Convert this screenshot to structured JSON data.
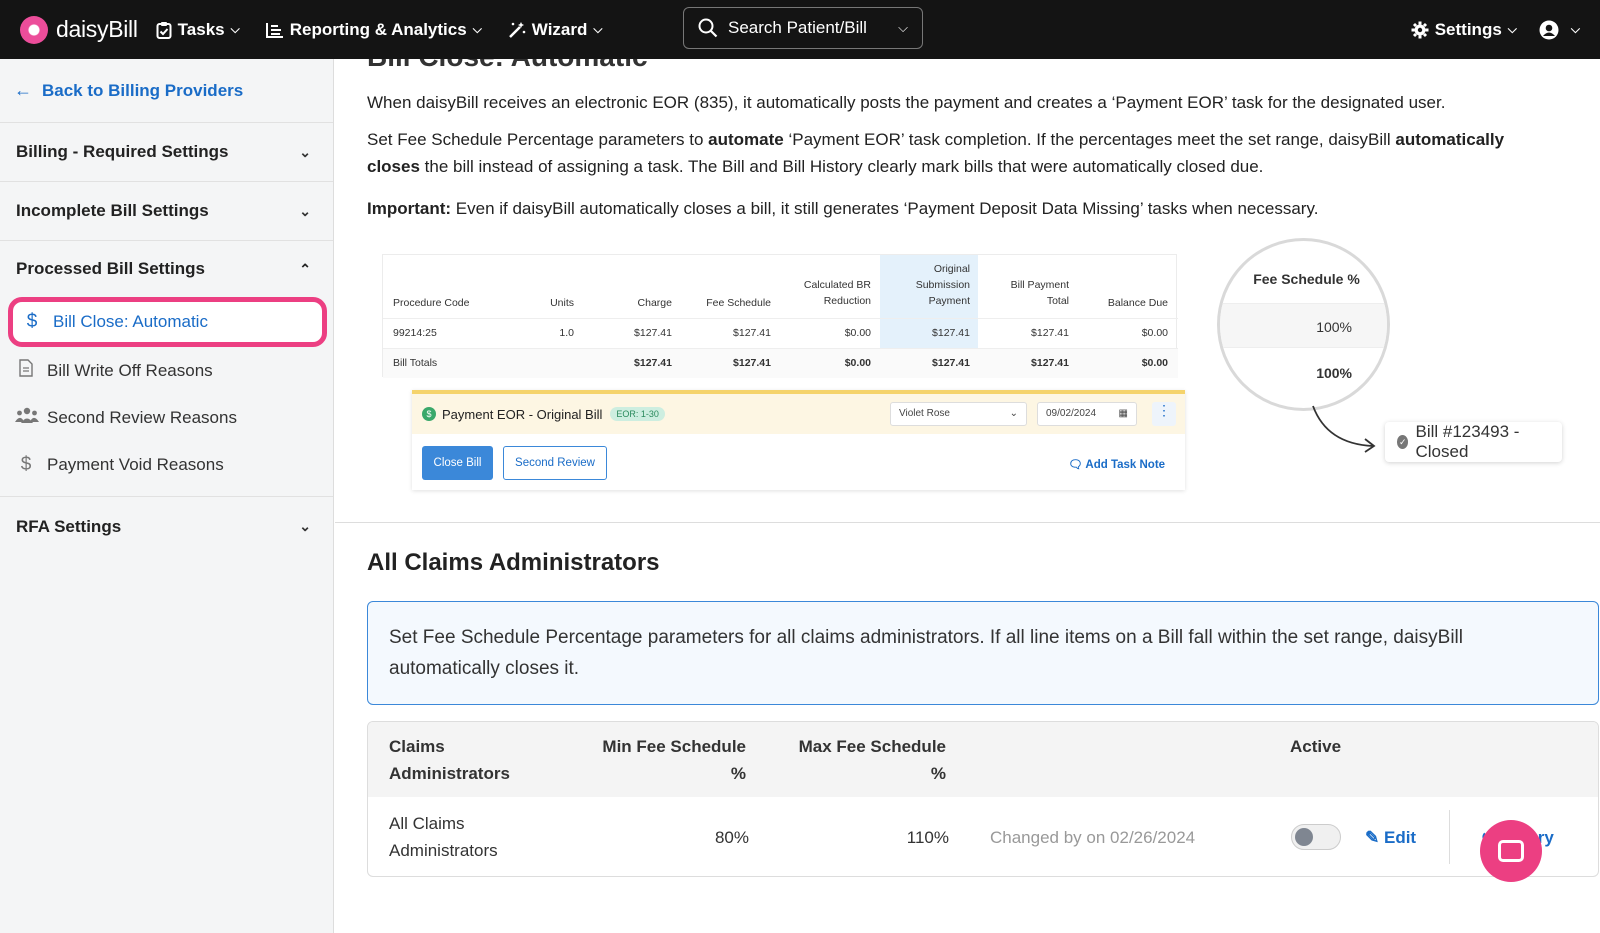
{
  "topbar": {
    "logo_text": "daisyBill",
    "nav": [
      {
        "label": "Tasks"
      },
      {
        "label": "Reporting & Analytics"
      },
      {
        "label": "Wizard"
      }
    ],
    "search_label": "Search Patient/Bill",
    "settings_label": "Settings"
  },
  "sidebar": {
    "back_label": "Back to Billing Providers",
    "sections": {
      "billing_required": "Billing - Required Settings",
      "incomplete_bill": "Incomplete Bill Settings",
      "processed_bill": "Processed Bill Settings",
      "rfa": "RFA Settings"
    },
    "items": [
      {
        "label": "Bill Close: Automatic",
        "icon": "dollar-icon",
        "active": true
      },
      {
        "label": "Bill Write Off Reasons",
        "icon": "document-icon",
        "active": false
      },
      {
        "label": "Second Review Reasons",
        "icon": "users-icon",
        "active": false
      },
      {
        "label": "Payment Void Reasons",
        "icon": "dollar-icon",
        "active": false
      }
    ]
  },
  "main": {
    "title": "Bill Close: Automatic",
    "intro_1": "When daisyBill receives an electronic EOR (835), it automatically posts the payment and creates a ‘Payment EOR’ task for the designated user.",
    "intro_2_a": "Set Fee Schedule Percentage parameters to ",
    "intro_2_b": "automate",
    "intro_2_c": " ‘Payment EOR’ task completion. If the percentages meet the set range, daisyBill ",
    "intro_2_d": "automatically closes",
    "intro_2_e": " the bill instead of assigning a task. The Bill and Bill History clearly mark bills that were automatically closed due.",
    "important_label": "Important:",
    "important_text": " Even if daisyBill automatically closes a bill, it still generates ‘Payment Deposit Data Missing’ tasks when necessary.",
    "figure": {
      "headers": [
        "Procedure Code",
        "Units",
        "Charge",
        "Fee Schedule",
        "Calculated BR Reduction",
        "Original Submission Payment",
        "Bill Payment Total",
        "Balance Due"
      ],
      "header_lines": {
        "calc_1": "Calculated BR",
        "calc_2": "Reduction",
        "orig_1": "Original",
        "orig_2": "Submission",
        "orig_3": "Payment",
        "bpt_1": "Bill Payment",
        "bpt_2": "Total"
      },
      "row": [
        "99214:25",
        "1.0",
        "$127.41",
        "$127.41",
        "$0.00",
        "$127.41",
        "$127.41",
        "$0.00"
      ],
      "totals": [
        "Bill Totals",
        "$127.41",
        "$127.41",
        "$0.00",
        "$127.41",
        "$127.41",
        "$0.00"
      ],
      "task_title": "Payment EOR - Original Bill",
      "task_tag": "EOR: 1-30",
      "assignee": "Violet Rose",
      "date": "09/02/2024",
      "close_btn": "Close Bill",
      "review_btn": "Second Review",
      "add_note": "Add Task Note",
      "mag_title": "Fee Schedule %",
      "mag_v1": "100%",
      "mag_v2": "100%",
      "closed_badge": "Bill #123493 - Closed"
    },
    "section_title": "All Claims Administrators",
    "info_text": "Set Fee Schedule Percentage parameters for all claims administrators. If all line items on a Bill fall within the set range, daisyBill automatically closes it.",
    "grid": {
      "h_admin_1": "Claims",
      "h_admin_2": "Administrators",
      "h_min_1": "Min Fee Schedule",
      "h_min_2": "%",
      "h_max_1": "Max Fee Schedule",
      "h_max_2": "%",
      "h_active": "Active",
      "row_admin_1": "All Claims",
      "row_admin_2": "Administrators",
      "row_min": "80%",
      "row_max": "110%",
      "row_changed": "Changed by on 02/26/2024",
      "row_active": false,
      "edit_label": "Edit",
      "history_label": "ry"
    }
  },
  "colors": {
    "brand_pink": "#ec3f82",
    "link_blue": "#1a6cc7",
    "topbar_bg": "#141414"
  }
}
